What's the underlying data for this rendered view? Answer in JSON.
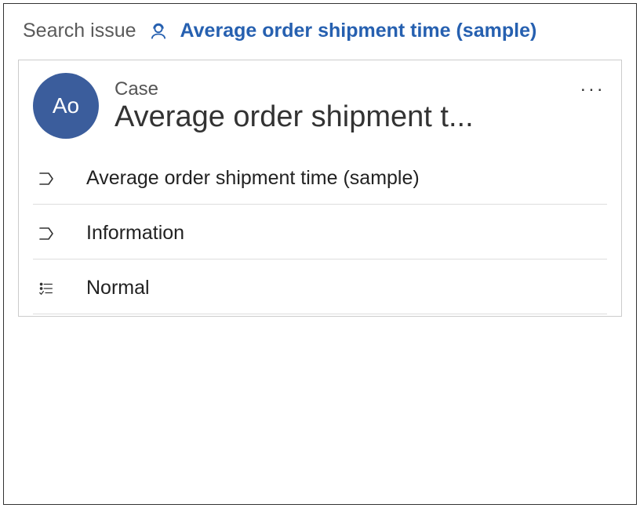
{
  "breadcrumb": {
    "root": "Search issue",
    "current": "Average order shipment time (sample)"
  },
  "card": {
    "avatar_initials": "Ao",
    "type_label": "Case",
    "title": "Average order shipment t...",
    "more_label": "..."
  },
  "fields": [
    {
      "icon": "chevron",
      "value": "Average order shipment time (sample)"
    },
    {
      "icon": "chevron",
      "value": "Information"
    },
    {
      "icon": "priority",
      "value": "Normal"
    }
  ]
}
